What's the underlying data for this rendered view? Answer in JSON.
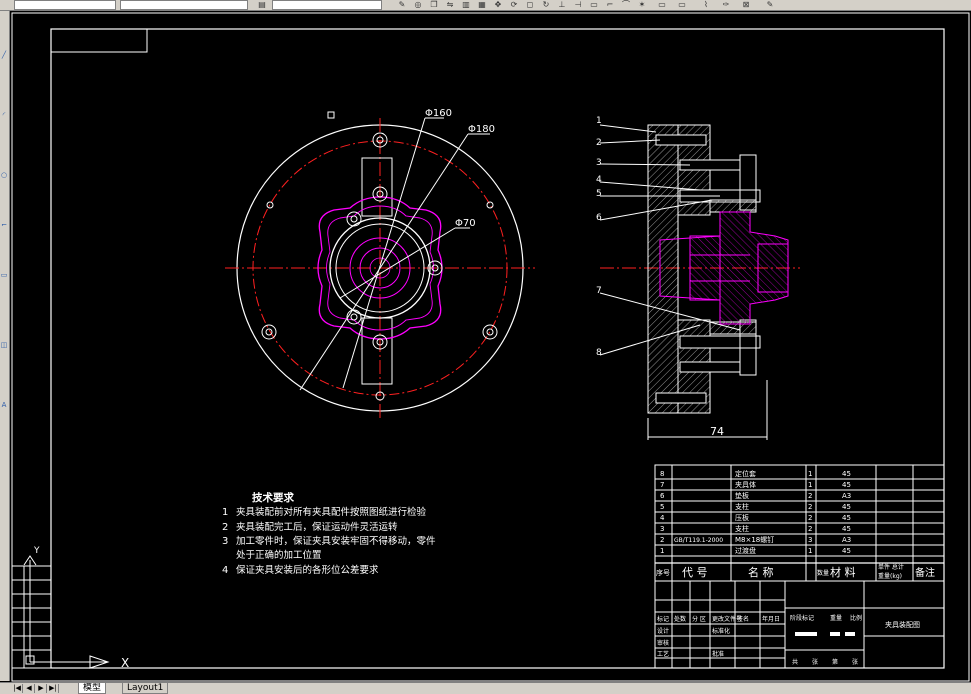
{
  "tabs": {
    "model": "模型",
    "layout1": "Layout1"
  },
  "dims": {
    "d160": "Φ160",
    "d180": "Φ180",
    "d70": "Φ70",
    "len74": "74"
  },
  "balloons": [
    "1",
    "2",
    "3",
    "4",
    "5",
    "6",
    "7",
    "8"
  ],
  "notes": {
    "title": "技术要求",
    "items": [
      {
        "num": "1",
        "text": "夹具装配前对所有夹具配件按照图纸进行检验"
      },
      {
        "num": "2",
        "text": "夹具装配完工后，保证运动件灵活运转"
      },
      {
        "num": "3",
        "text": "加工零件时，保证夹具安装牢固不得移动，零件"
      },
      {
        "num": "",
        "text": "处于正确的加工位置"
      },
      {
        "num": "4",
        "text": "保证夹具安装后的各形位公差要求"
      }
    ]
  },
  "bom": {
    "rows": [
      {
        "no": "8",
        "code": "",
        "name": "定位套",
        "qty": "1",
        "mat": "45"
      },
      {
        "no": "7",
        "code": "",
        "name": "夹具体",
        "qty": "1",
        "mat": "45"
      },
      {
        "no": "6",
        "code": "",
        "name": "垫板",
        "qty": "2",
        "mat": "A3"
      },
      {
        "no": "5",
        "code": "",
        "name": "支柱",
        "qty": "2",
        "mat": "45"
      },
      {
        "no": "4",
        "code": "",
        "name": "压板",
        "qty": "2",
        "mat": "45"
      },
      {
        "no": "3",
        "code": "",
        "name": "支柱",
        "qty": "2",
        "mat": "45"
      },
      {
        "no": "2",
        "code": "GB/T119.1-2000",
        "name": "M8×18螺钉",
        "qty": "3",
        "mat": "A3"
      },
      {
        "no": "1",
        "code": "",
        "name": "过渡盘",
        "qty": "1",
        "mat": "45"
      }
    ],
    "header": {
      "no": "序号",
      "code": "代  号",
      "name": "名  称",
      "qty": "数量",
      "mat": "材  料",
      "weight1": "单件 总计",
      "weight2": "重量(kg)",
      "note": "备注"
    }
  },
  "titleblock": {
    "name": "夹具装配图",
    "r1": "标记",
    "r2": "处数",
    "r3": "分 区",
    "r4": "更改文件号",
    "r5": "签名",
    "r6": "年月日",
    "r7": "设计",
    "r8": "标准化",
    "r9": "审核",
    "r10": "工艺",
    "r11": "批准",
    "r12": "阶段标记",
    "r13": "重量",
    "r14": "比例",
    "r15": "共",
    "r16": "张",
    "r17": "第",
    "r18": "张"
  },
  "ucs": {
    "x": "X",
    "y": "Y"
  },
  "colors": {
    "white": "#ffffff",
    "red": "#ff2020",
    "magenta": "#ff00ff",
    "cyan": "#00ffff",
    "yellow": "#ffff00"
  }
}
